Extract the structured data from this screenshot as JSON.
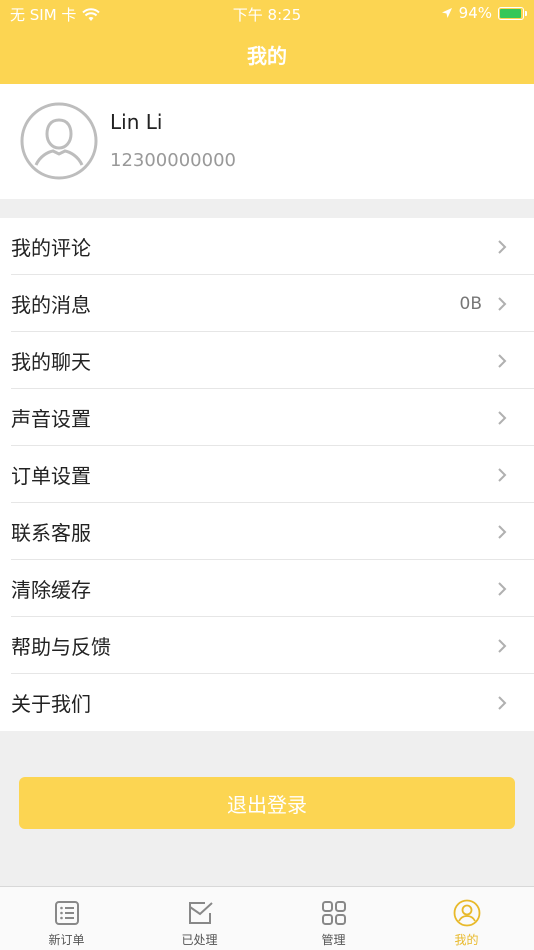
{
  "status_bar": {
    "carrier": "无 SIM 卡",
    "time": "下午 8:25",
    "battery": "94%",
    "battery_level": 0.94
  },
  "header": {
    "title": "我的"
  },
  "profile": {
    "name": "Lin Li",
    "phone": "12300000000"
  },
  "menu": {
    "items": [
      {
        "label": "我的评论",
        "value": ""
      },
      {
        "label": "我的消息",
        "value": "0B"
      },
      {
        "label": "我的聊天",
        "value": ""
      },
      {
        "label": "声音设置",
        "value": ""
      },
      {
        "label": "订单设置",
        "value": ""
      },
      {
        "label": "联系客服",
        "value": ""
      },
      {
        "label": "清除缓存",
        "value": ""
      },
      {
        "label": "帮助与反馈",
        "value": ""
      },
      {
        "label": "关于我们",
        "value": ""
      }
    ]
  },
  "logout": {
    "label": "退出登录"
  },
  "tabbar": {
    "tabs": [
      {
        "label": "新订单",
        "icon": "list-icon",
        "active": false
      },
      {
        "label": "已处理",
        "icon": "checked-mail-icon",
        "active": false
      },
      {
        "label": "管理",
        "icon": "grid-icon",
        "active": false
      },
      {
        "label": "我的",
        "icon": "user-icon",
        "active": true
      }
    ]
  },
  "colors": {
    "accent": "#fcd552",
    "active_tab": "#e8b92a",
    "background": "#efefef"
  }
}
